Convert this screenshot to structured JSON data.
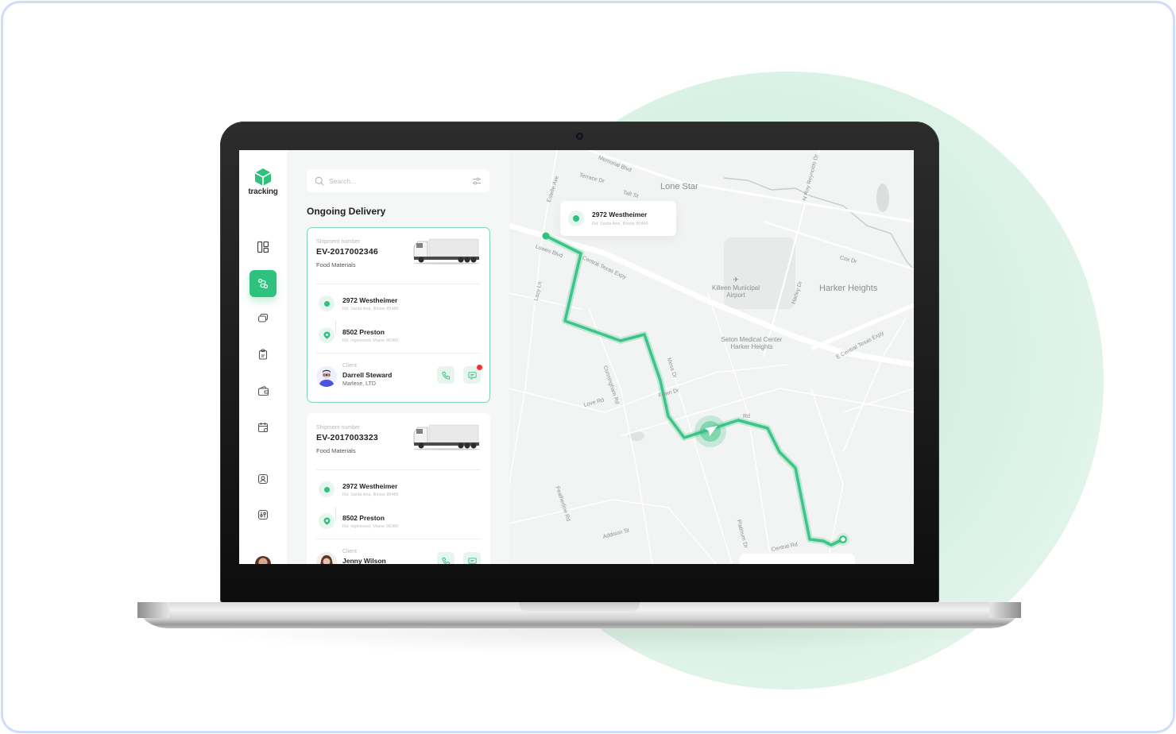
{
  "colors": {
    "accent": "#2ec27e",
    "accent_light": "#e6f6ee",
    "frame_border": "#cfdcfa",
    "notification": "#ff2d2d"
  },
  "app": {
    "logo_icon": "cube-icon",
    "name": "tracking"
  },
  "sidebar": {
    "items": [
      {
        "name": "dashboard",
        "icon": "dashboard-grid-icon",
        "active": false
      },
      {
        "name": "routes",
        "icon": "route-icon",
        "active": true
      },
      {
        "name": "messages",
        "icon": "chat-bubbles-icon",
        "active": false
      },
      {
        "name": "clipboard",
        "icon": "clipboard-icon",
        "active": false
      },
      {
        "name": "wallet",
        "icon": "wallet-icon",
        "active": false
      },
      {
        "name": "calendar",
        "icon": "calendar-icon",
        "active": false
      },
      {
        "name": "profile",
        "icon": "user-card-icon",
        "active": false
      },
      {
        "name": "settings",
        "icon": "sliders-icon",
        "active": false
      }
    ]
  },
  "search": {
    "placeholder": "Search...",
    "filter_icon": "filter-sliders-icon"
  },
  "section_title": "Ongoing Delivery",
  "deliveries": [
    {
      "shipment_label": "Shipment number",
      "shipment_number": "EV-2017002346",
      "cargo": "Food Materials",
      "selected": true,
      "origin": {
        "title": "2972 Westheimer",
        "subtitle": "Rd. Santa Ana, Illinois 85486"
      },
      "destination": {
        "title": "8502 Preston",
        "subtitle": "Rd. Inglewood, Maine 98380"
      },
      "client_label": "Client",
      "client_name": "Darrell Steward",
      "client_company": "Marlene, LTD",
      "has_unread_message": true
    },
    {
      "shipment_label": "Shipment number",
      "shipment_number": "EV-2017003323",
      "cargo": "Food Materials",
      "selected": false,
      "origin": {
        "title": "2972 Westheimer",
        "subtitle": "Rd. Santa Ana, Illinois 85486"
      },
      "destination": {
        "title": "8502 Preston",
        "subtitle": "Rd. Inglewood, Maine 98380"
      },
      "client_label": "Client",
      "client_name": "Jenny Wilson",
      "client_company": "",
      "has_unread_message": false
    }
  ],
  "map": {
    "popup": {
      "title": "2972 Westheimer",
      "subtitle": "Rd. Santa Ana, Illinois 85486"
    },
    "towns": [
      "Lone Star",
      "Harker Heights"
    ],
    "pois": [
      "Killeen Municipal Airport",
      "Seton Medical Center Harker Heights"
    ],
    "streets": [
      "Memorial Blvd",
      "Terrace Dr",
      "Taft St",
      "Estelle Ave",
      "N Roy Reynolds Dr",
      "Lowes Blvd",
      "Central Texas Expy",
      "Cox Dr",
      "Harley Dr",
      "E Central Texas Expy",
      "Lazy Ln",
      "Mesa Dr",
      "Fawn Dr",
      "Love Rd",
      "Cunningham Rd",
      "Rd",
      "Featherline Rd",
      "Addison St",
      "Platinum Dr",
      "Central Rd"
    ]
  }
}
